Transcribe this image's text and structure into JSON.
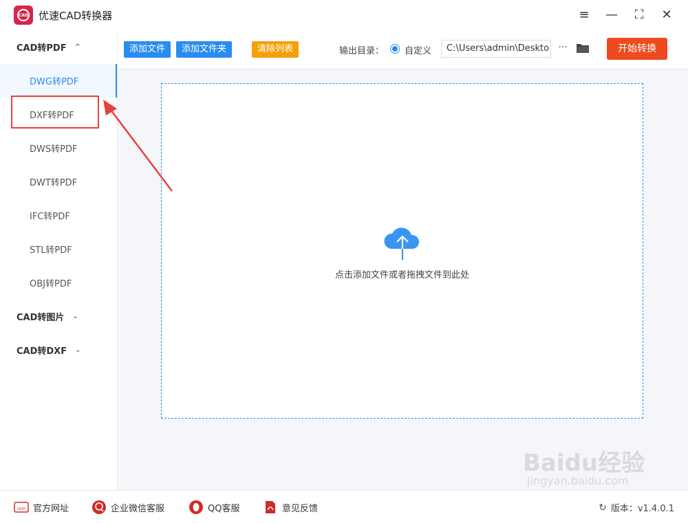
{
  "app": {
    "title": "优速CAD转换器",
    "logo_text": "CAD"
  },
  "window_controls": {
    "menu": "≡",
    "minimize": "—",
    "maximize": "⛶",
    "close": "✕"
  },
  "sidebar": {
    "groups": [
      {
        "label": "CAD转PDF",
        "expanded": true,
        "chevron": "^",
        "items": [
          "DWG转PDF",
          "DXF转PDF",
          "DWS转PDF",
          "DWT转PDF",
          "IFC转PDF",
          "STL转PDF",
          "OBJ转PDF"
        ],
        "active_index": 0
      },
      {
        "label": "CAD转图片",
        "expanded": false,
        "chevron": "⌄"
      },
      {
        "label": "CAD转DXF",
        "expanded": false,
        "chevron": "⌄"
      }
    ]
  },
  "toolbar": {
    "add_file": "添加文件",
    "add_folder": "添加文件夹",
    "clear_list": "清除列表",
    "output_label": "输出目录：",
    "custom_option": "自定义",
    "output_path": "C:\\Users\\admin\\Deskto",
    "more": "···",
    "start": "开始转换"
  },
  "dropzone": {
    "hint": "点击添加文件或者拖拽文件到此处",
    "icon": "cloud-upload-icon"
  },
  "footer": {
    "website": "官方网址",
    "wechat": "企业微信客服",
    "qq": "QQ客服",
    "feedback": "意见反馈",
    "version": "版本：v1.4.0.1"
  },
  "watermark": {
    "brand": "Baidu经验",
    "sub": "jingyan.baidu.com"
  },
  "colors": {
    "accent": "#2a8cf0",
    "start": "#ee4a1f",
    "clear": "#f5a00b",
    "annotation": "#e8403a",
    "logo": "#d9254a"
  }
}
